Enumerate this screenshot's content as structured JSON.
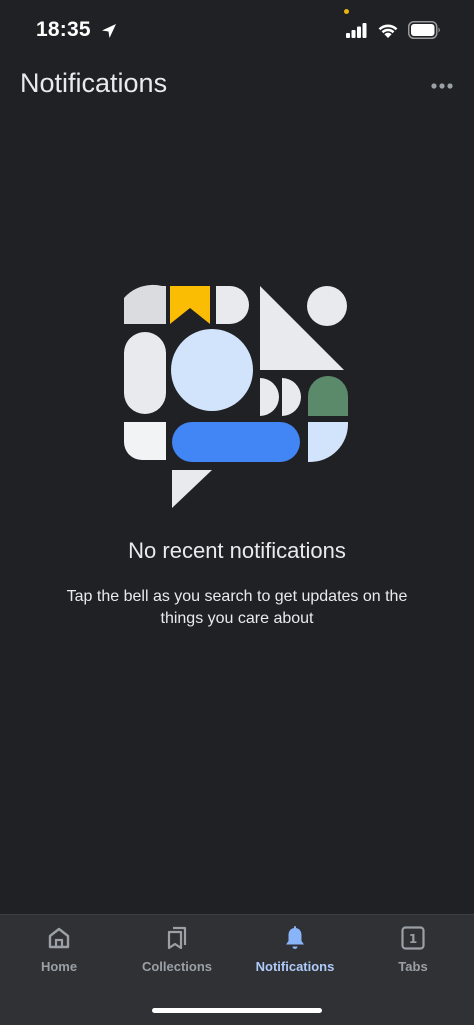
{
  "status_bar": {
    "time": "18:35",
    "icons": [
      "location-arrow-icon",
      "signal-icon",
      "wifi-icon",
      "battery-icon"
    ]
  },
  "header": {
    "title": "Notifications",
    "more_icon": "more-horizontal-icon"
  },
  "empty_state": {
    "title": "No recent notifications",
    "description": "Tap the bell as you search to get updates on the things you care about"
  },
  "bottom_nav": {
    "items": [
      {
        "label": "Home",
        "icon": "home-icon",
        "active": false
      },
      {
        "label": "Collections",
        "icon": "collections-icon",
        "active": false
      },
      {
        "label": "Notifications",
        "icon": "bell-icon",
        "active": true
      },
      {
        "label": "Tabs",
        "icon": "tabs-icon",
        "badge": "1",
        "active": false
      }
    ]
  },
  "colors": {
    "background": "#202124",
    "nav_background": "#303134",
    "text_primary": "#e8eaed",
    "nav_inactive": "#9aa0a6",
    "nav_active": "#aecbfa",
    "illustration_light": "#e8eaed",
    "illustration_yellow": "#fbbc04",
    "illustration_blue": "#4285f4",
    "illustration_green": "#5b8a6b"
  }
}
